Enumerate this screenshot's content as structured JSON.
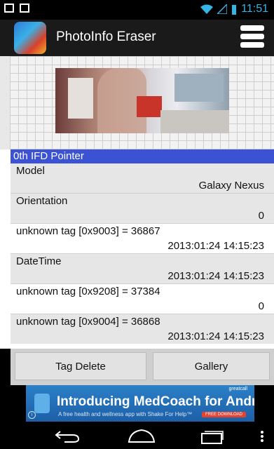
{
  "status_bar": {
    "time": "11:51",
    "icons": [
      "image-icon",
      "bag-icon",
      "wifi-icon",
      "signal-icon",
      "battery-icon"
    ]
  },
  "action_bar": {
    "title": "PhotoInfo Eraser",
    "menu_icon": "menu-icon"
  },
  "section": {
    "title": "0th IFD Pointer"
  },
  "items": [
    {
      "key": "Model",
      "value": "Galaxy Nexus"
    },
    {
      "key": "Orientation",
      "value": "0"
    },
    {
      "key": "unknown tag [0x9003] = 36867",
      "value": "2013:01:24 14:15:23"
    },
    {
      "key": "DateTime",
      "value": "2013:01:24 14:15:23"
    },
    {
      "key": "unknown tag [0x9208] = 37384",
      "value": "0"
    },
    {
      "key": "unknown tag [0x9004] = 36868",
      "value": "2013:01:24 14:15:23"
    }
  ],
  "buttons": {
    "delete": "Tag Delete",
    "gallery": "Gallery"
  },
  "ad": {
    "title": "Introducing MedCoach for Android®",
    "subtitle": "A free health and wellness app with Shake For Help™",
    "brand": "greatcall",
    "cta": "FREE DOWNLOAD",
    "info": "i"
  },
  "colors": {
    "accent": "#33b5e5",
    "section_header": "#3a52d3"
  }
}
